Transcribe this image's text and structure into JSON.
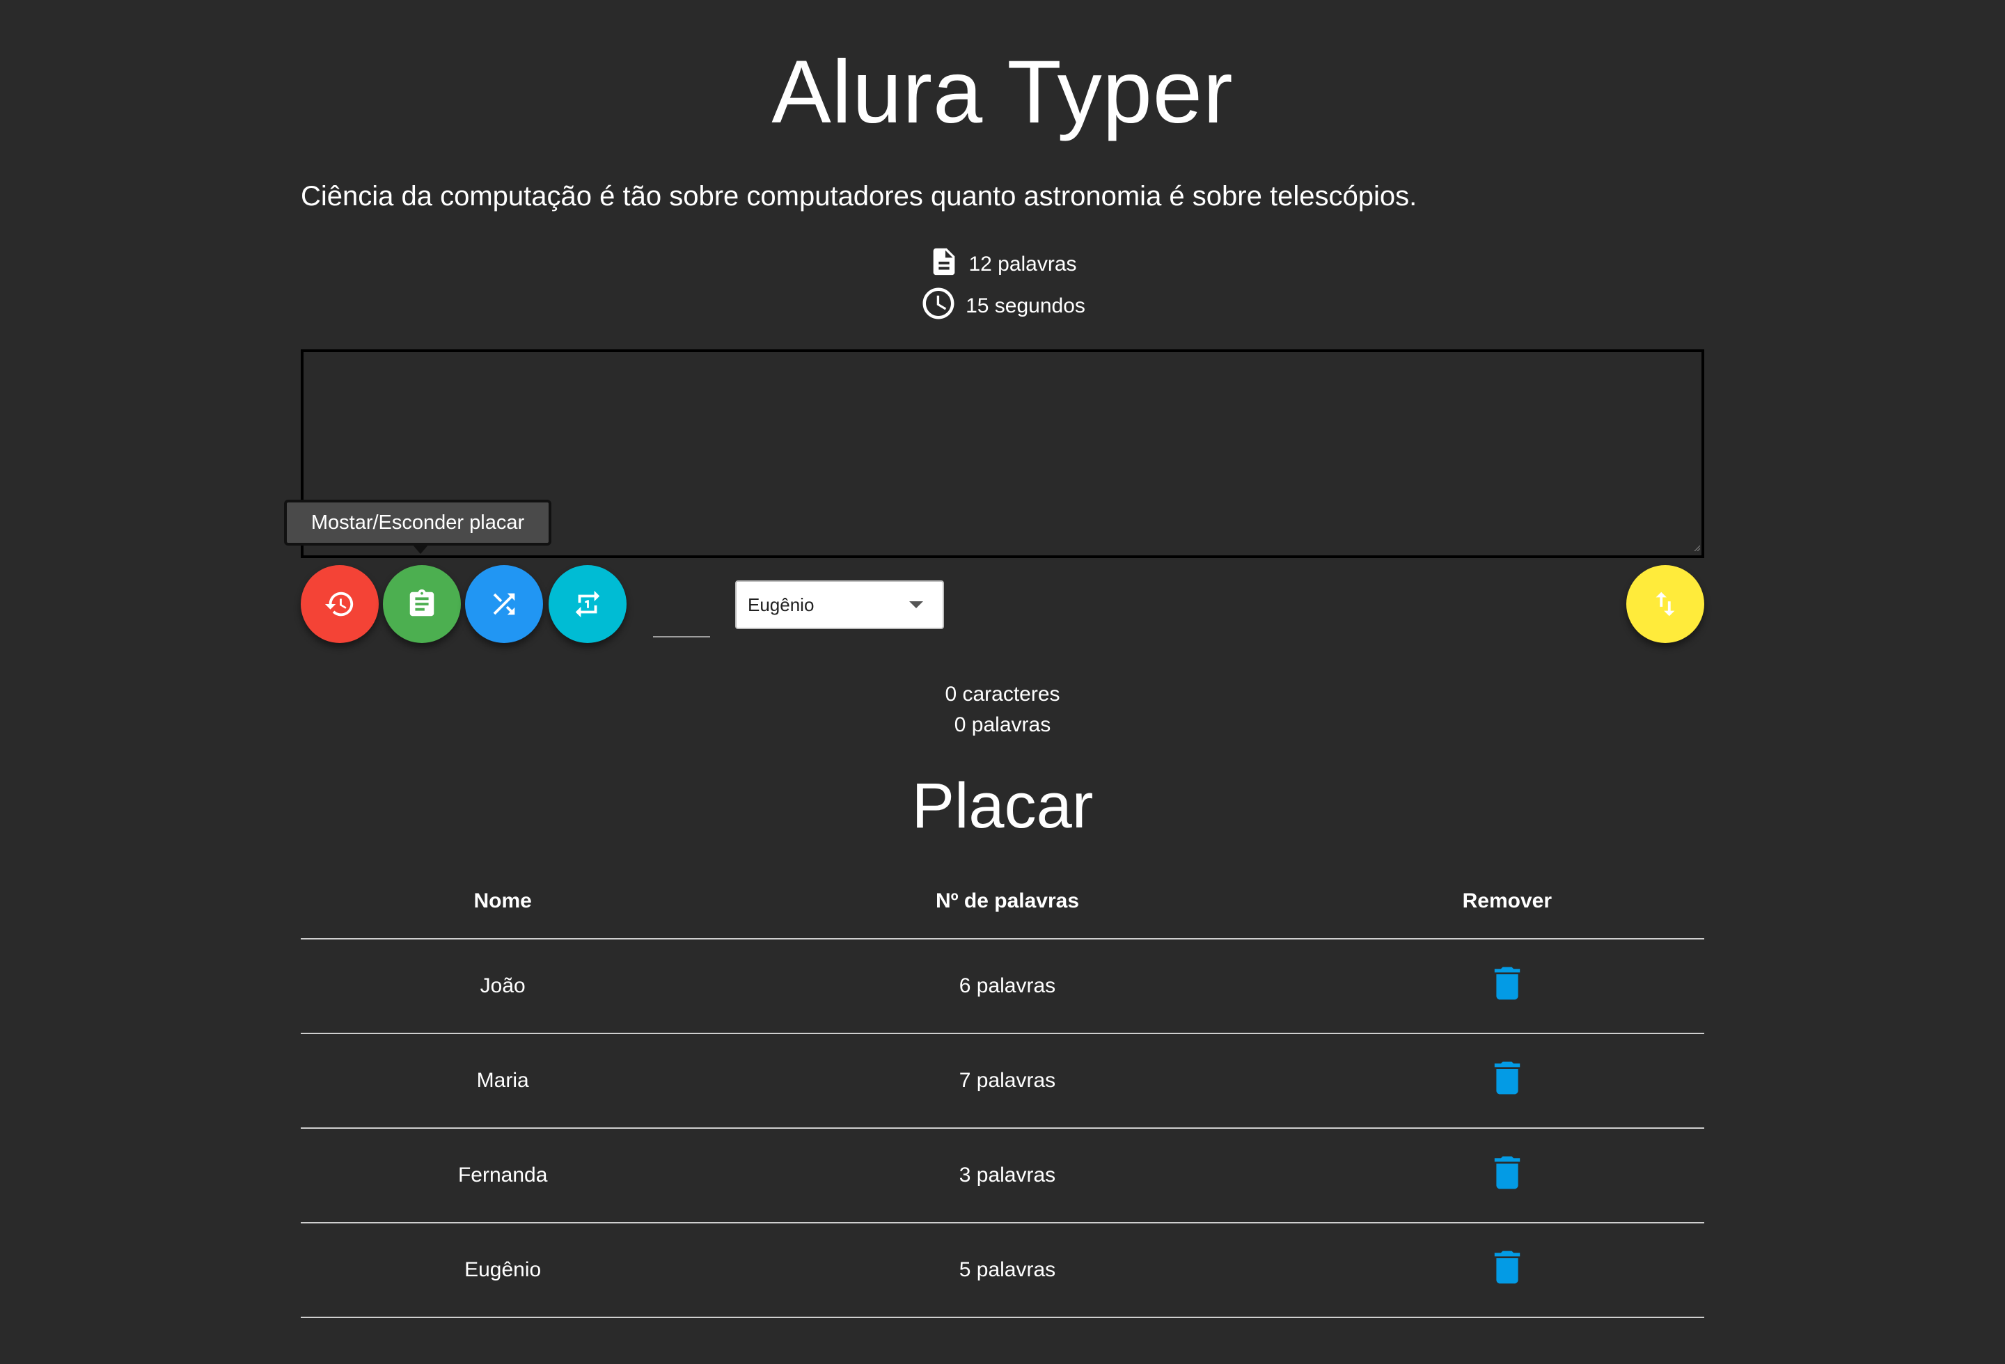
{
  "app": {
    "title": "Alura Typer",
    "phrase": "Ciência da computação é tão sobre computadores quanto astronomia é sobre telescópios."
  },
  "info": {
    "word_count_label": "12 palavras",
    "time_label": "15 segundos"
  },
  "typing_area": {
    "value": "",
    "placeholder": ""
  },
  "tooltip": {
    "text": "Mostar/Esconder placar"
  },
  "controls": {
    "buttons": [
      {
        "name": "restart",
        "icon": "history-icon",
        "color": "#f44336"
      },
      {
        "name": "toggle-scoreboard",
        "icon": "clipboard-icon",
        "color": "#4caf50"
      },
      {
        "name": "shuffle-phrase",
        "icon": "shuffle-icon",
        "color": "#2196f3"
      },
      {
        "name": "repeat-phrase",
        "icon": "repeat-one-icon",
        "color": "#00bcd4"
      },
      {
        "name": "sync",
        "icon": "swap-vert-icon",
        "color": "#ffeb3b"
      }
    ],
    "time_input_value": "",
    "user_select": {
      "selected": "Eugênio"
    }
  },
  "counters": {
    "characters": "0 caracteres",
    "words": "0 palavras"
  },
  "scoreboard": {
    "title": "Placar",
    "headers": [
      "Nome",
      "Nº de palavras",
      "Remover"
    ],
    "rows": [
      {
        "name": "João",
        "words": "6 palavras"
      },
      {
        "name": "Maria",
        "words": "7 palavras"
      },
      {
        "name": "Fernanda",
        "words": "3 palavras"
      },
      {
        "name": "Eugênio",
        "words": "5 palavras"
      }
    ],
    "trash_color": "#039be5"
  }
}
